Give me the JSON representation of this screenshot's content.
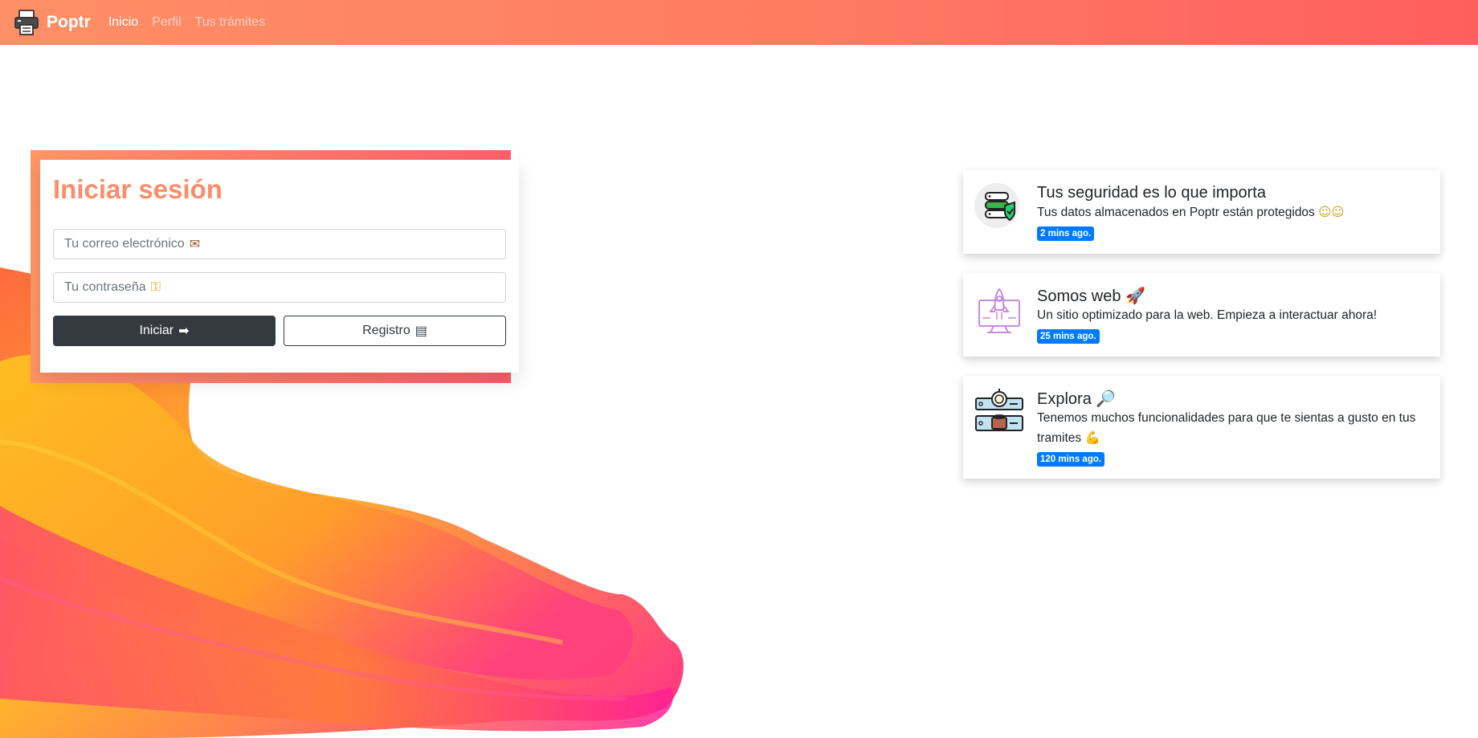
{
  "nav": {
    "brand": "Poptr",
    "links": [
      {
        "label": "Inicio",
        "active": true
      },
      {
        "label": "Perfil",
        "active": false
      },
      {
        "label": "Tus trámites",
        "active": false
      }
    ]
  },
  "login": {
    "title": "Iniciar sesión",
    "email_placeholder": "Tu correo electrónico",
    "email_glyph": "✉",
    "password_placeholder": "Tu contraseña",
    "password_glyph": "⚿",
    "login_button": "Iniciar",
    "login_glyph": "➡",
    "register_button": "Registro",
    "register_glyph": "▤"
  },
  "features": [
    {
      "title": "Tus seguridad es lo que importa",
      "text": "Tus datos almacenados en Poptr están protegidos",
      "text_emoji": "☺☺",
      "badge": "2 mins ago.",
      "icon": "server-shield-icon"
    },
    {
      "title": "Somos web",
      "title_emoji": "🚀",
      "text": "Un sitio optimizado para la web. Empieza a interactuar ahora!",
      "badge": "25 mins ago.",
      "icon": "rocket-monitor-icon"
    },
    {
      "title": "Explora",
      "title_emoji": "🔎",
      "text": "Tenemos muchos funcionalidades para que te sientas a gusto en tus tramites",
      "text_emoji": "💪",
      "badge": "120 mins ago.",
      "icon": "explore-panels-icon"
    }
  ],
  "colors": {
    "nav_start": "#ff8f66",
    "nav_end": "#ff5e5e",
    "title_color": "#fb8d6a",
    "badge": "#007bff",
    "dark_button": "#343a40"
  }
}
